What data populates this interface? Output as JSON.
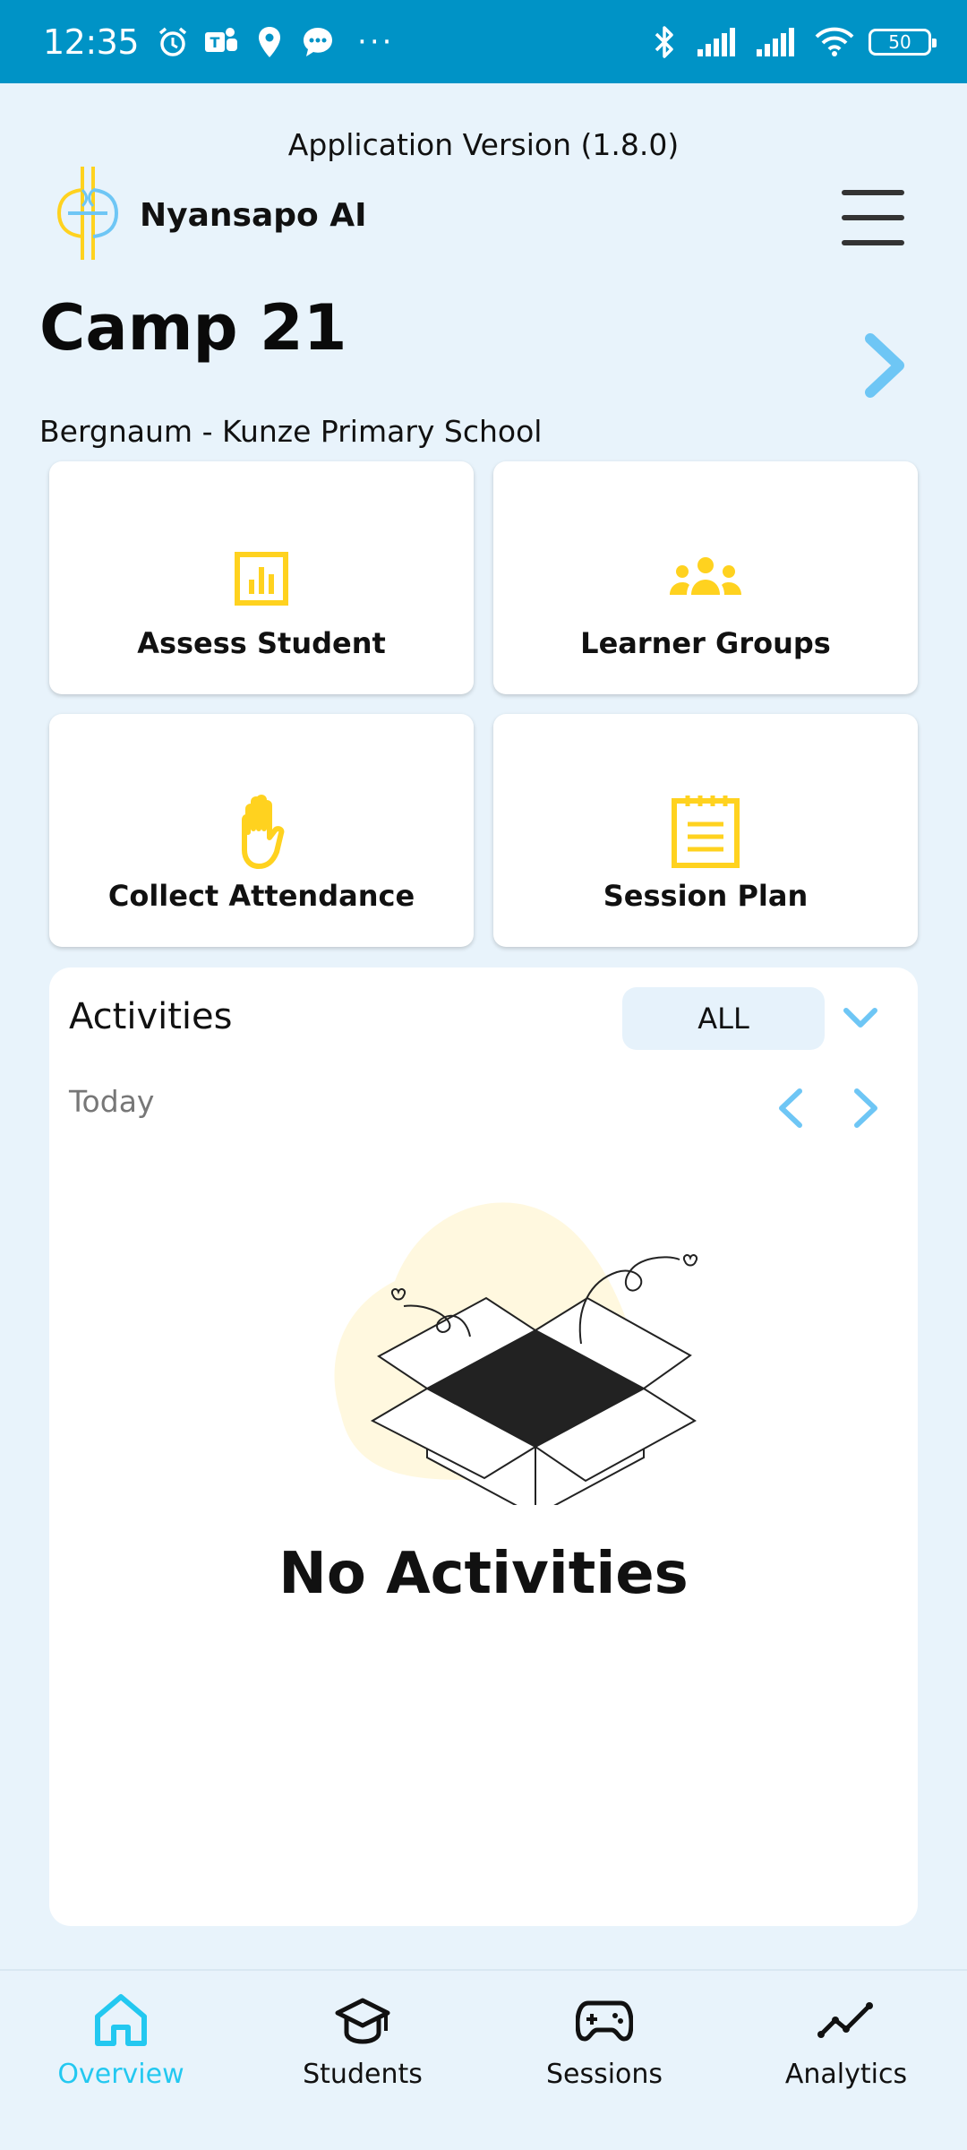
{
  "status_bar": {
    "time": "12:35",
    "battery": "50",
    "more": "···"
  },
  "header": {
    "app_version": "Application Version (1.8.0)",
    "brand_name": "Nyansapo AI"
  },
  "camp": {
    "title": "Camp 21",
    "school": "Bergnaum - Kunze Primary School"
  },
  "tiles": [
    {
      "label": "Assess Student",
      "icon": "bar-chart-icon"
    },
    {
      "label": "Learner Groups",
      "icon": "group-icon"
    },
    {
      "label": "Collect Attendance",
      "icon": "hand-icon"
    },
    {
      "label": "Session Plan",
      "icon": "notepad-icon"
    }
  ],
  "activities": {
    "title": "Activities",
    "filter": "ALL",
    "date": "Today",
    "empty_message": "No Activities"
  },
  "bottom_nav": [
    {
      "label": "Overview",
      "icon": "home-icon",
      "active": true
    },
    {
      "label": "Students",
      "icon": "graduation-cap-icon",
      "active": false
    },
    {
      "label": "Sessions",
      "icon": "gamepad-icon",
      "active": false
    },
    {
      "label": "Analytics",
      "icon": "trend-line-icon",
      "active": false
    }
  ],
  "colors": {
    "accent": "#23C8F0",
    "tile_icon": "#FFD21F",
    "status_bar": "#0093C6",
    "arrow": "#6EC6F5",
    "background": "#E8F3FB"
  }
}
